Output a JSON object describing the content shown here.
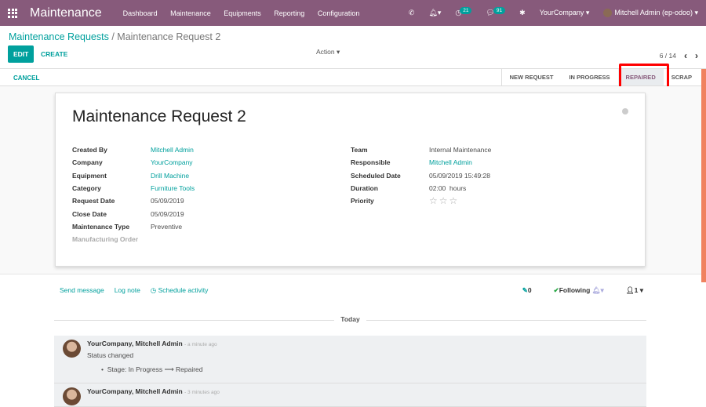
{
  "nav": {
    "brand": "Maintenance",
    "menu": [
      "Dashboard",
      "Maintenance",
      "Equipments",
      "Reporting",
      "Configuration"
    ],
    "activity_count": "21",
    "message_count": "91",
    "company": "YourCompany",
    "user": "Mitchell Admin (ep-odoo)"
  },
  "breadcrumb": {
    "parent": "Maintenance Requests",
    "current": "Maintenance Request 2"
  },
  "toolbar": {
    "edit": "EDIT",
    "create": "CREATE",
    "action": "Action",
    "pager": "6 / 14"
  },
  "statusbar": {
    "cancel": "CANCEL",
    "stages": [
      "NEW REQUEST",
      "IN PROGRESS",
      "REPAIRED",
      "SCRAP"
    ],
    "current": "REPAIRED"
  },
  "form": {
    "title": "Maintenance Request 2",
    "left": [
      {
        "label": "Created By",
        "value": "Mitchell Admin",
        "link": true
      },
      {
        "label": "Company",
        "value": "YourCompany",
        "link": true
      },
      {
        "label": "Equipment",
        "value": "Drill Machine",
        "link": true
      },
      {
        "label": "Category",
        "value": "Furniture Tools",
        "link": true
      },
      {
        "label": "Request Date",
        "value": "05/09/2019"
      },
      {
        "label": "Close Date",
        "value": "05/09/2019"
      },
      {
        "label": "Maintenance Type",
        "value": "Preventive"
      },
      {
        "label": "Manufacturing Order",
        "value": ""
      }
    ],
    "right": [
      {
        "label": "Team",
        "value": "Internal Maintenance"
      },
      {
        "label": "Responsible",
        "value": "Mitchell Admin",
        "link": true
      },
      {
        "label": "Scheduled Date",
        "value": "05/09/2019 15:49:28"
      },
      {
        "label": "Duration",
        "value": "02:00",
        "unit": "hours"
      },
      {
        "label": "Priority",
        "value": "",
        "stars": 0
      }
    ]
  },
  "chatter": {
    "send": "Send message",
    "log": "Log note",
    "schedule": "Schedule activity",
    "attachments": "0",
    "following": "Following",
    "followers": "1",
    "today": "Today",
    "messages": [
      {
        "author": "YourCompany, Mitchell Admin",
        "time": "- a minute ago",
        "body": "Status changed",
        "tracking": "Stage: In Progress ⟶ Repaired"
      },
      {
        "author": "YourCompany, Mitchell Admin",
        "time": "- 3 minutes ago"
      }
    ]
  }
}
